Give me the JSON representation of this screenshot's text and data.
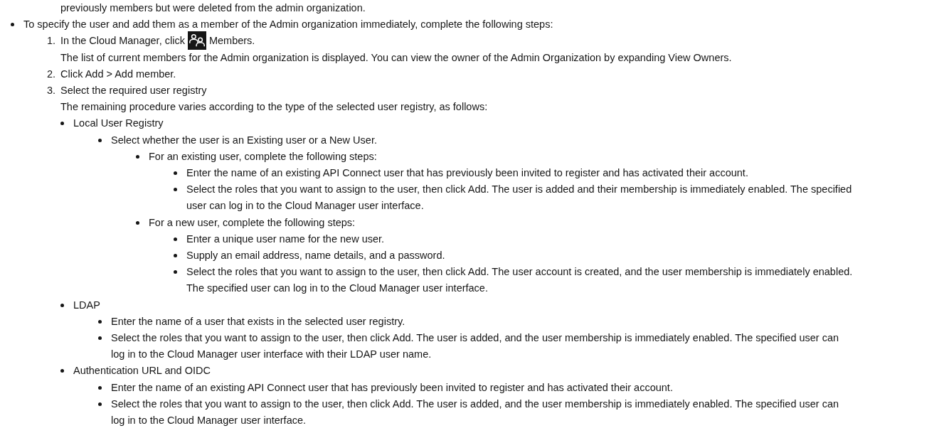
{
  "fragment": "previously members but were deleted from the admin organization.",
  "items": [
    {
      "text": "To specify the user and add them as a member of the Admin organization immediately, complete the following steps:",
      "steps": [
        {
          "number": "1.",
          "text": "In the Cloud Manager, click",
          "after_icon": "Members.",
          "note": "The list of current members for the Admin organization is displayed. You can view the owner of the Admin Organization by expanding View Owners."
        },
        {
          "number": "2.",
          "text": "Click Add > Add member."
        },
        {
          "number": "3.",
          "text": "Select the required user registry",
          "note": "The remaining procedure varies according to the type of the selected user registry, as follows:",
          "children": [
            {
              "text": "Local User Registry",
              "children": [
                {
                  "text": "Select whether the user is an Existing user or a New User.",
                  "children": [
                    {
                      "text": "For an existing user, complete the following steps:",
                      "children": [
                        {
                          "text": "Enter the name of an existing API Connect user that has previously been invited to register and has activated their account."
                        },
                        {
                          "text": "Select the roles that you want to assign to the user, then click Add. The user is added and their membership is immediately enabled. The specified user can log in to the Cloud Manager user interface."
                        }
                      ]
                    },
                    {
                      "text": "For a new user, complete the following steps:",
                      "children": [
                        {
                          "text": "Enter a unique user name for the new user."
                        },
                        {
                          "text": "Supply an email address, name details, and a password."
                        },
                        {
                          "text": "Select the roles that you want to assign to the user, then click Add. The user account is created, and the user membership is immediately enabled. The specified user can log in to the Cloud Manager user interface."
                        }
                      ]
                    }
                  ]
                }
              ]
            },
            {
              "text": "LDAP",
              "children": [
                {
                  "text": "Enter the name of a user that exists in the selected user registry."
                },
                {
                  "text": "Select the roles that you want to assign to the user, then click Add. The user is added, and the user membership is immediately enabled. The specified user can log in to the Cloud Manager user interface with their LDAP user name."
                }
              ]
            },
            {
              "text": "Authentication URL and OIDC",
              "children": [
                {
                  "text": "Enter the name of an existing API Connect user that has previously been invited to register and has activated their account."
                },
                {
                  "text": "Select the roles that you want to assign to the user, then click Add. The user is added, and the user membership is immediately enabled. The specified user can log in to the Cloud Manager user interface."
                }
              ]
            }
          ]
        }
      ]
    }
  ]
}
